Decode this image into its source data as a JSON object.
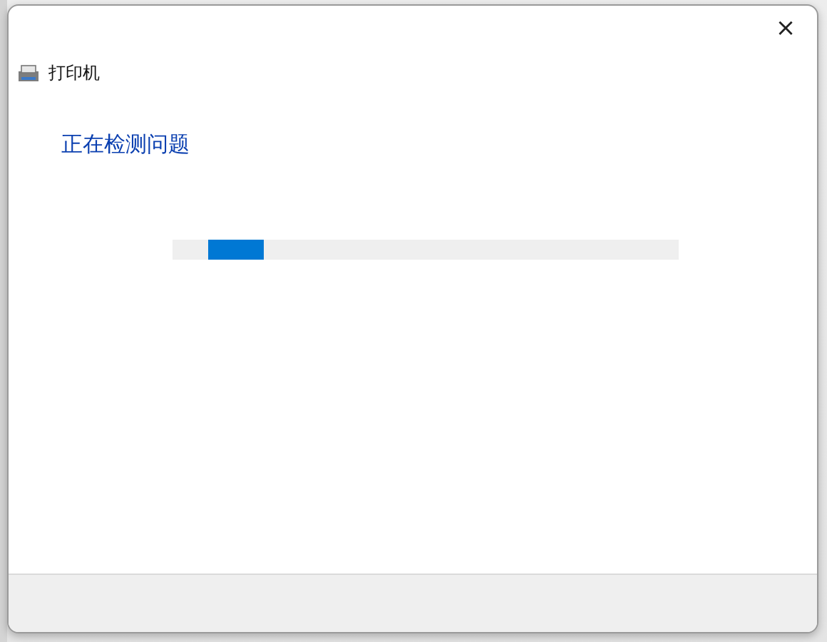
{
  "window": {
    "title": "打印机",
    "close": "×"
  },
  "status": {
    "heading": "正在检测问题"
  },
  "progress": {
    "level": 0.11
  }
}
